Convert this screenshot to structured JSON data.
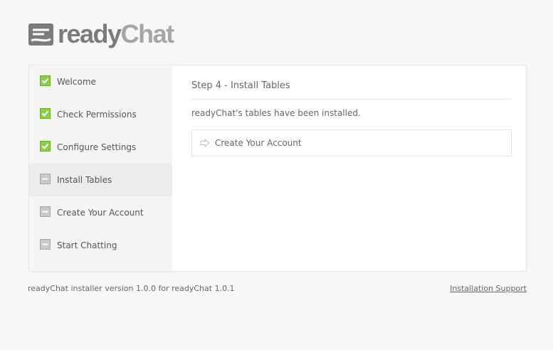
{
  "brand": {
    "name_part1": "ready",
    "name_part2": "Chat"
  },
  "steps": [
    {
      "label": "Welcome",
      "status": "complete"
    },
    {
      "label": "Check Permissions",
      "status": "complete"
    },
    {
      "label": "Configure Settings",
      "status": "complete"
    },
    {
      "label": "Install Tables",
      "status": "current"
    },
    {
      "label": "Create Your Account",
      "status": "pending"
    },
    {
      "label": "Start Chatting",
      "status": "pending"
    }
  ],
  "main": {
    "title": "Step 4 - Install Tables",
    "message": "readyChat's tables have been installed.",
    "next_action_label": "Create Your Account"
  },
  "footer": {
    "version": "readyChat installer version 1.0.0 for readyChat 1.0.1",
    "support_link": "Installation Support"
  },
  "colors": {
    "check_green": "#7cc23a",
    "pending_gray": "#b5b5b5",
    "active_step_bg": "#ececec"
  }
}
